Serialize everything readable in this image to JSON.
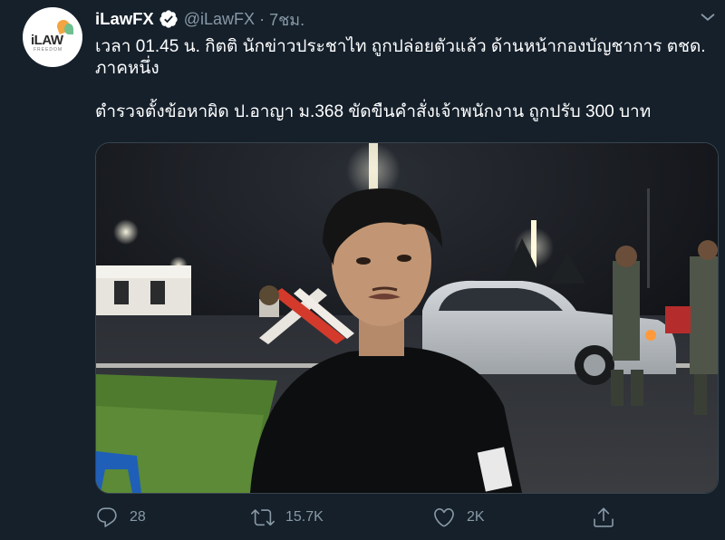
{
  "tweet": {
    "author": {
      "display_name": "iLawFX",
      "handle": "@iLawFX",
      "time": "7ชม.",
      "separator": "·",
      "avatar_logo_text": "iLAW",
      "avatar_logo_sub": "FREEDOM",
      "verified_icon": "verified-badge-icon"
    },
    "text": "เวลา 01.45 น. กิตติ นักข่าวประชาไท ถูกปล่อยตัวแล้ว ด้านหน้ากองบัญชาการ ตชด. ภาคหนึ่ง\n\nตำรวจตั้งข้อหาผิด ป.อาญา ม.368 ขัดขืนคำสั่งเจ้าพนักงาน ถูกปรับ 300 บาท",
    "media": {
      "kind": "photo"
    },
    "actions": {
      "reply_count": "28",
      "retweet_count": "15.7K",
      "like_count": "2K"
    }
  },
  "colors": {
    "background": "#15202b",
    "secondary_text": "#8899a6",
    "primary_text": "#ffffff",
    "verified": "#ffffff"
  }
}
